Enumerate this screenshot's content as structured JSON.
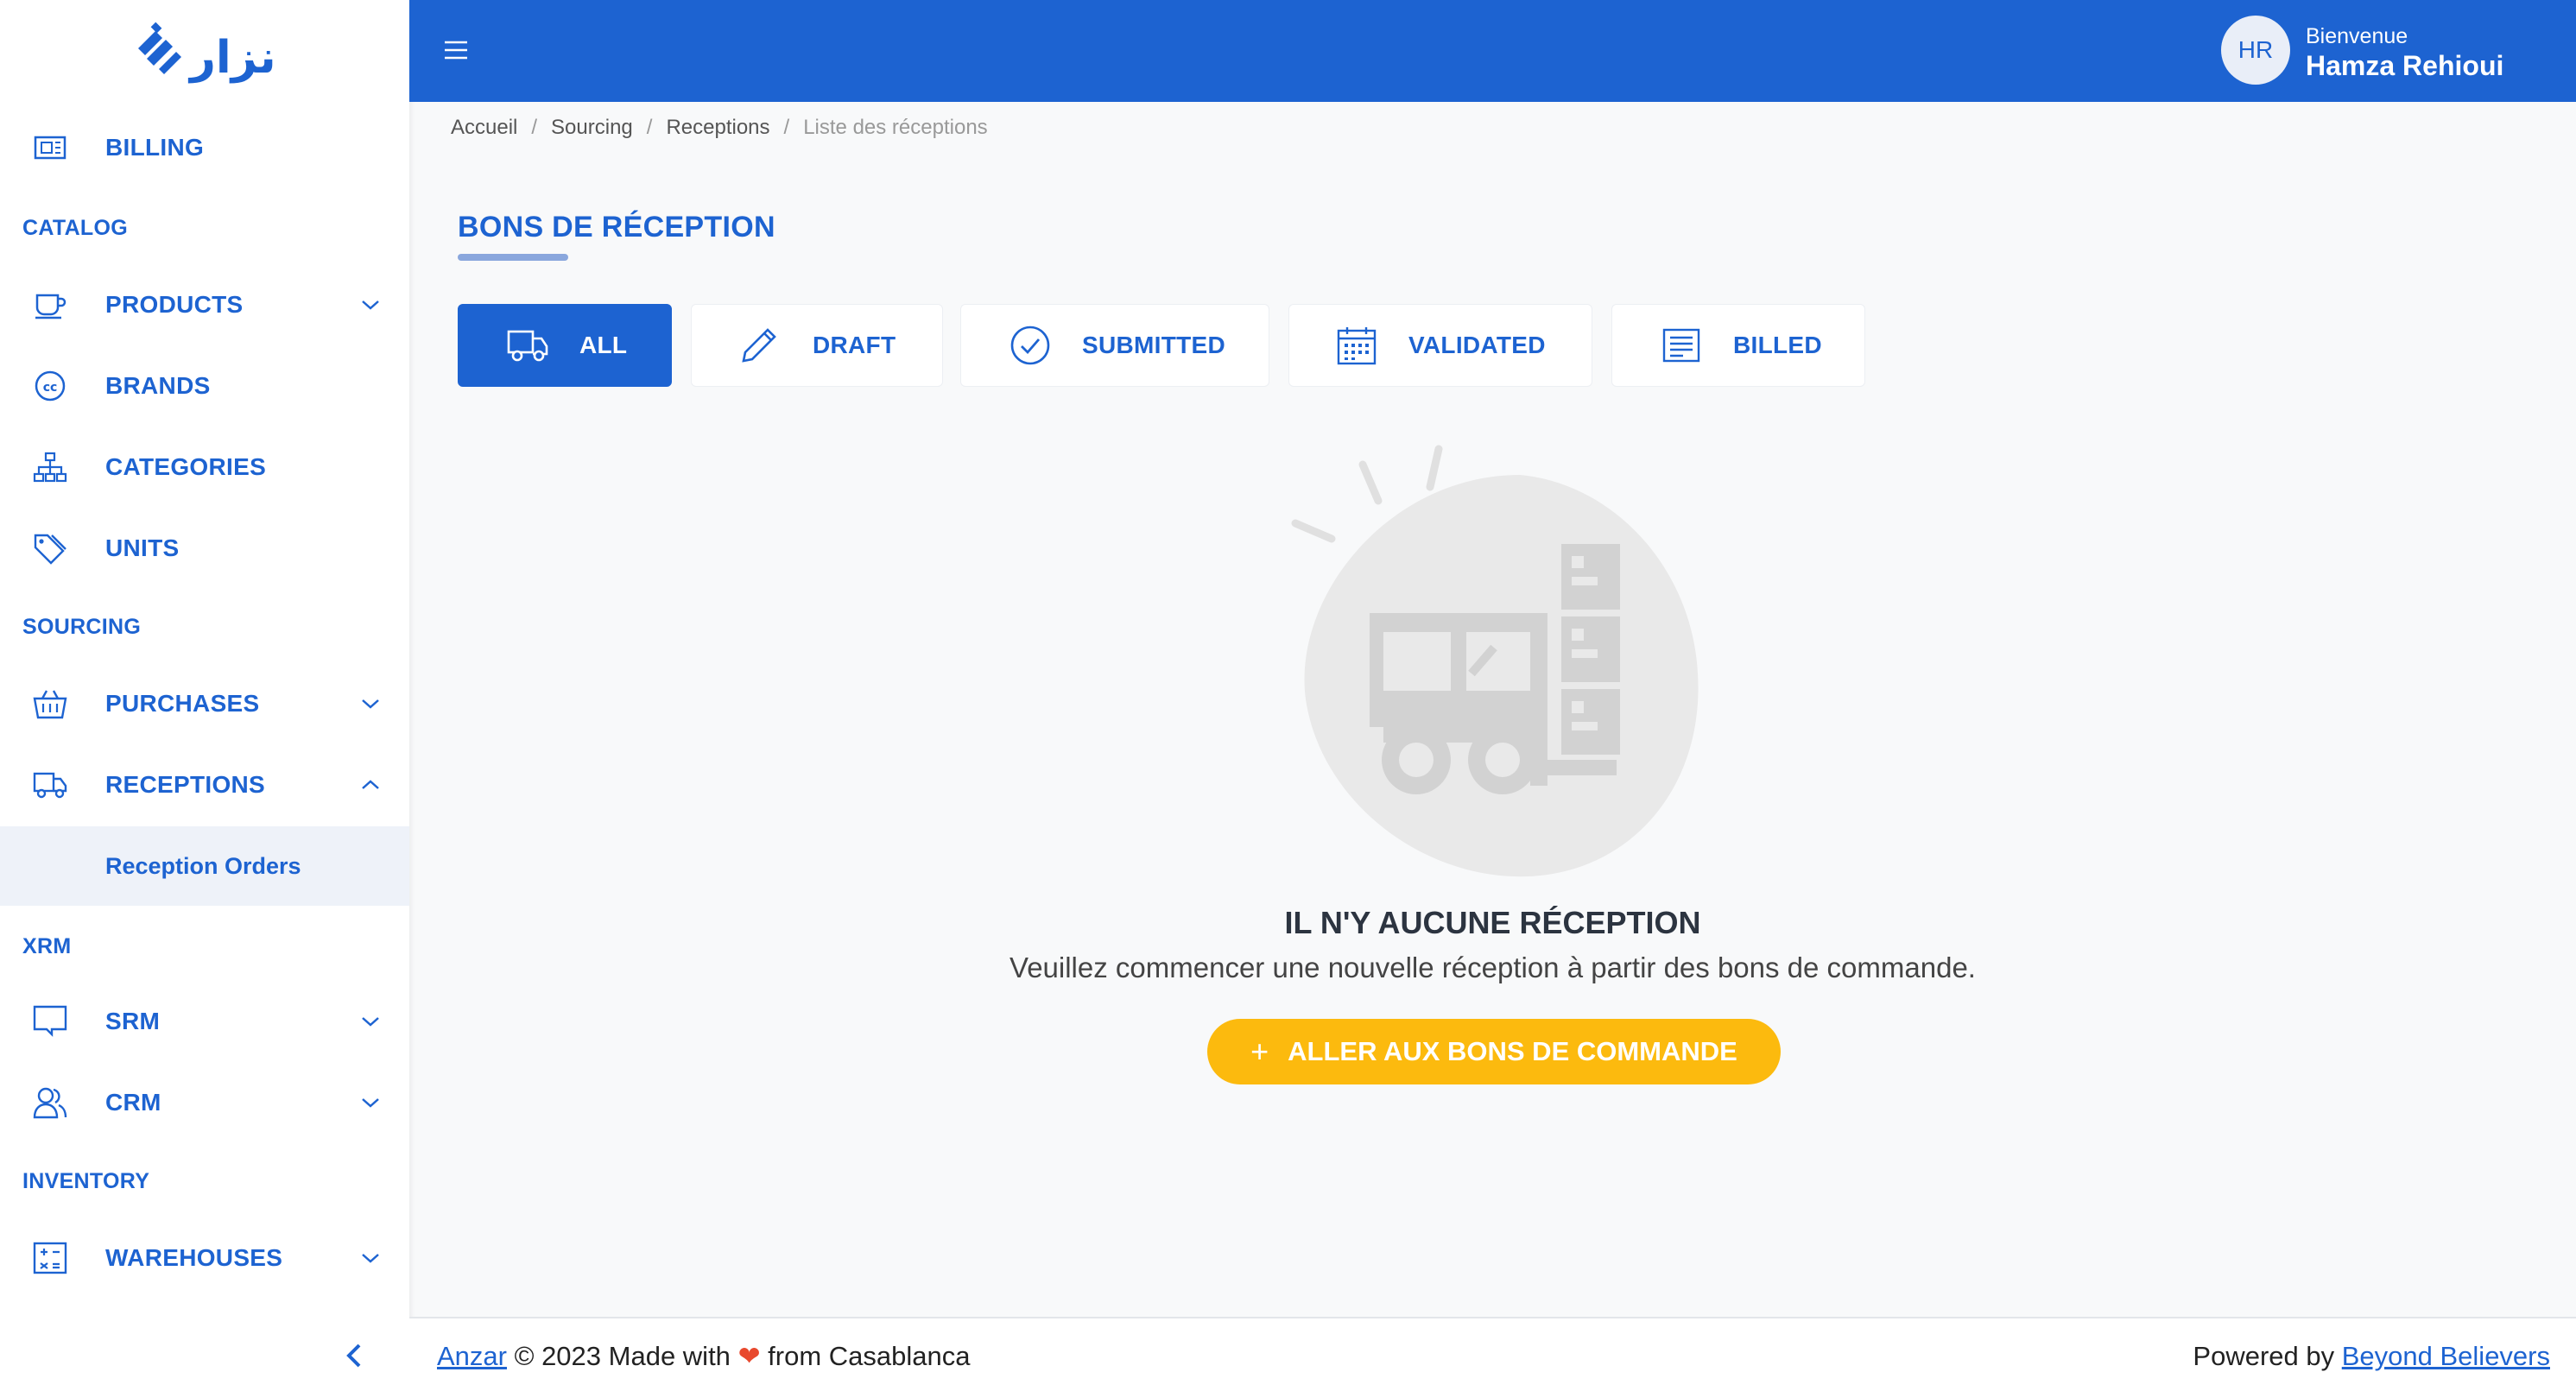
{
  "app": {
    "logo_text": "أنزار",
    "brand_color": "#1d63d1",
    "accent_color": "#fcba0e"
  },
  "sidebar": {
    "billing": {
      "label": "BILLING",
      "icon": "invoice-icon"
    },
    "sections": {
      "catalog": "CATALOG",
      "sourcing": "SOURCING",
      "xrm": "XRM",
      "inventory": "INVENTORY"
    },
    "products": {
      "label": "PRODUCTS",
      "icon": "cup-icon"
    },
    "brands": {
      "label": "BRANDS",
      "icon": "copyright-circle-icon"
    },
    "categories": {
      "label": "CATEGORIES",
      "icon": "hierarchy-icon"
    },
    "units": {
      "label": "UNITS",
      "icon": "tags-icon"
    },
    "purchases": {
      "label": "PURCHASES",
      "icon": "basket-icon"
    },
    "receptions": {
      "label": "RECEPTIONS",
      "icon": "truck-icon",
      "expanded": true
    },
    "reception_orders": {
      "label": "Reception Orders"
    },
    "srm": {
      "label": "SRM",
      "icon": "monitor-icon"
    },
    "crm": {
      "label": "CRM",
      "icon": "users-icon"
    },
    "warehouses": {
      "label": "WAREHOUSES",
      "icon": "warehouse-icon"
    }
  },
  "header": {
    "avatar_initials": "HR",
    "welcome": "Bienvenue",
    "user_name": "Hamza Rehioui"
  },
  "breadcrumb": {
    "home": "Accueil",
    "sourcing": "Sourcing",
    "receptions": "Receptions",
    "current": "Liste des réceptions",
    "separator": "/"
  },
  "page": {
    "title": "BONS DE RÉCEPTION"
  },
  "tabs": [
    {
      "label": "ALL",
      "icon": "truck-icon",
      "active": true
    },
    {
      "label": "DRAFT",
      "icon": "pencil-icon",
      "active": false
    },
    {
      "label": "SUBMITTED",
      "icon": "check-circle-icon",
      "active": false
    },
    {
      "label": "VALIDATED",
      "icon": "calendar-icon",
      "active": false
    },
    {
      "label": "BILLED",
      "icon": "document-icon",
      "active": false
    }
  ],
  "empty_state": {
    "illustration": "forklift-illustration",
    "title": "IL N'Y AUCUNE RÉCEPTION",
    "message": "Veuillez commencer une nouvelle réception à partir des bons de commande.",
    "cta_label": "ALLER AUX BONS DE COMMANDE"
  },
  "footer": {
    "brand_link": "Anzar",
    "copyright": "© 2023 Made with",
    "heart": "❤",
    "from": "from Casablanca",
    "powered_by": "Powered by",
    "powered_link": "Beyond Believers"
  }
}
